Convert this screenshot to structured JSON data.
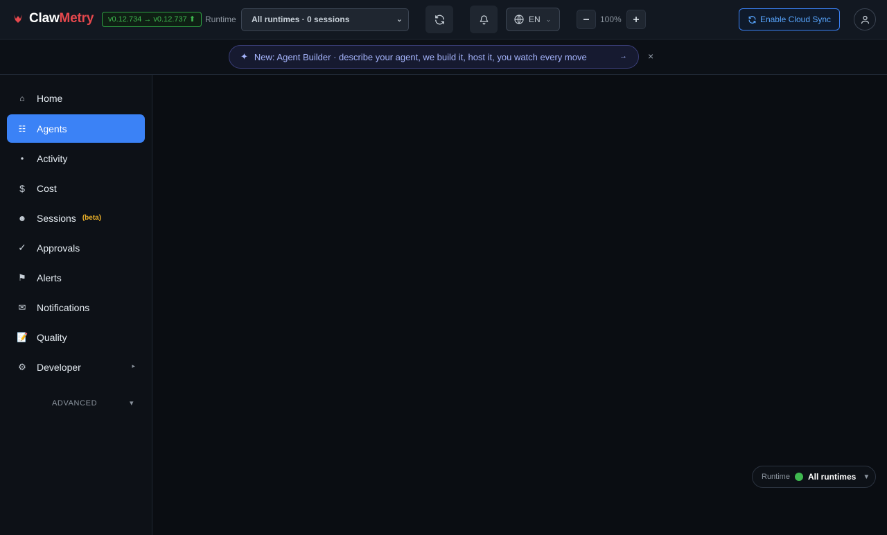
{
  "header": {
    "logo": {
      "part1": "Claw",
      "part2": "Metry"
    },
    "version": "v0.12.734 → v0.12.737 ⬆",
    "runtime_label": "Runtime",
    "runtime_select": "All runtimes · 0 sessions",
    "icons": {
      "refresh": "refresh-icon",
      "bell": "bell-icon",
      "globe": "globe-icon"
    },
    "language": "EN",
    "zoom": "100%",
    "cloud_sync": "Enable Cloud Sync"
  },
  "banner": {
    "text": "New: Agent Builder · describe your agent, we build it, host it, you watch every move",
    "arrow": "→",
    "close": "×"
  },
  "sidebar": {
    "items": [
      {
        "label": "Home",
        "icon": "⌂"
      },
      {
        "label": "Agents",
        "icon": "☷"
      },
      {
        "label": "Activity",
        "icon": "●"
      },
      {
        "label": "Cost",
        "icon": "$"
      },
      {
        "label": "Sessions",
        "icon": "☻",
        "badge": "(beta)"
      },
      {
        "label": "Approvals",
        "icon": "✓"
      },
      {
        "label": "Alerts",
        "icon": "⚑"
      },
      {
        "label": "Notifications",
        "icon": "✉"
      },
      {
        "label": "Quality",
        "icon": "📝"
      },
      {
        "label": "Developer",
        "icon": "⚙"
      }
    ],
    "advanced": "ADVANCED"
  },
  "runtime_pill": {
    "label": "Runtime",
    "value": "All runtimes"
  },
  "colors": {
    "accent": "#3b82f6",
    "brand_red": "#e5484d",
    "success": "#3fb950"
  }
}
